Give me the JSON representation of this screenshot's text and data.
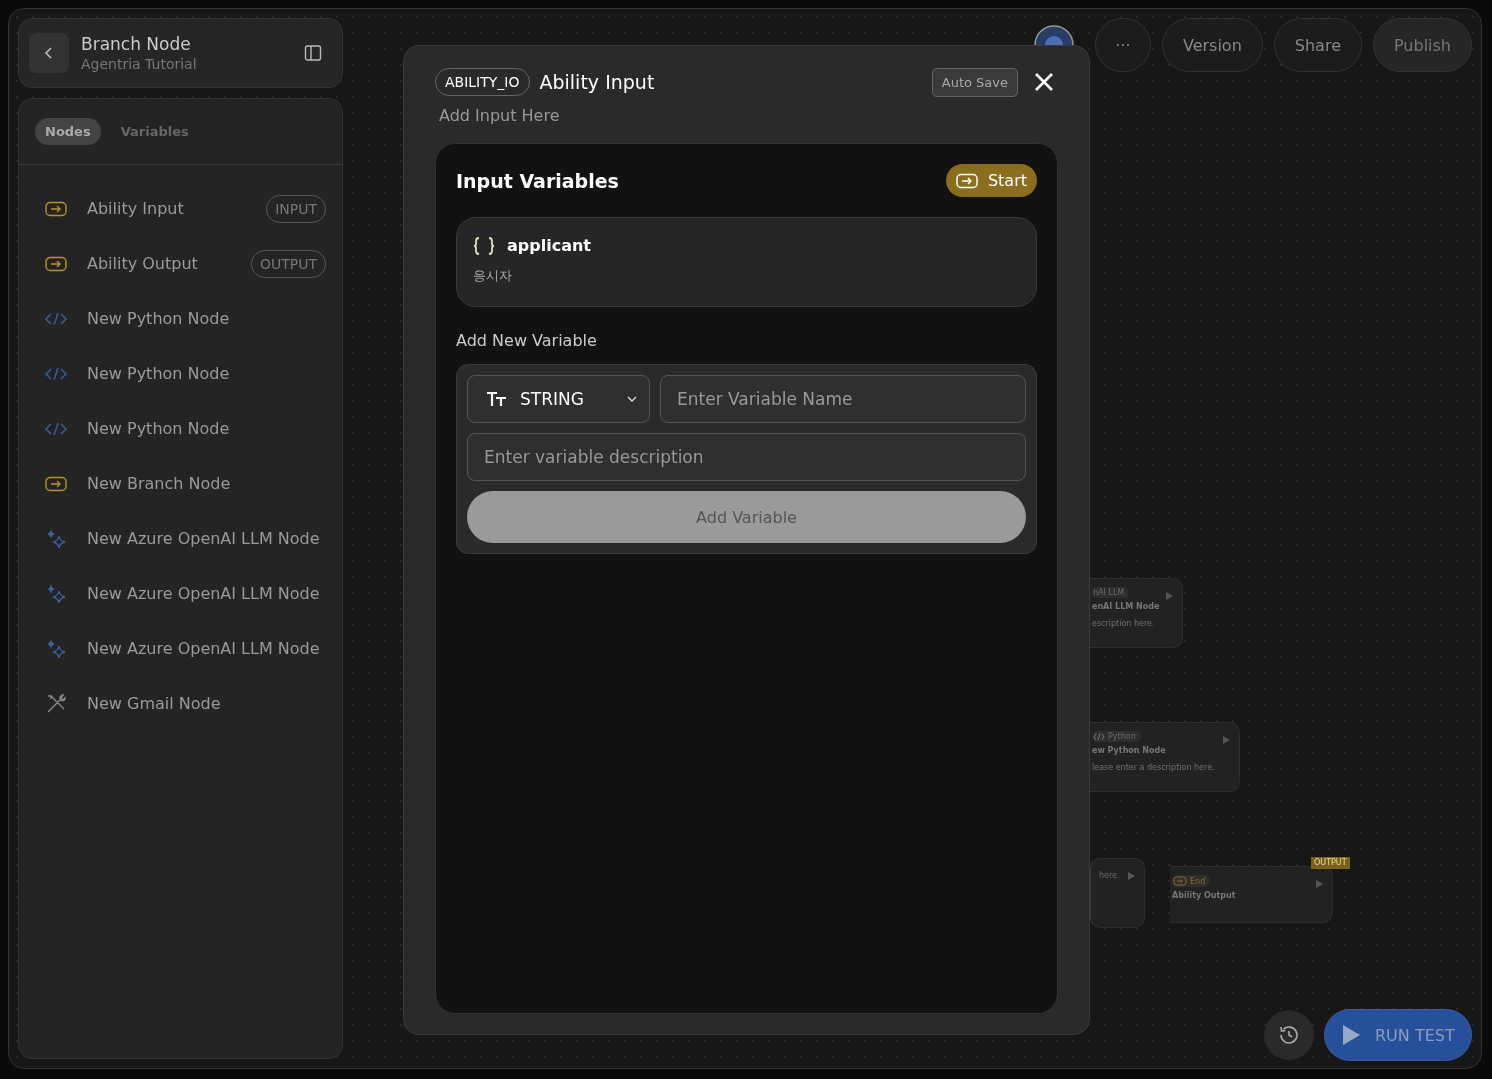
{
  "header": {
    "title": "Branch Node",
    "subtitle": "Agentria Tutorial"
  },
  "sidebar": {
    "tabs": [
      {
        "label": "Nodes",
        "selected": true
      },
      {
        "label": "Variables",
        "selected": false
      }
    ],
    "items": [
      {
        "label": "Ability Input",
        "kind": "io",
        "badge": "INPUT"
      },
      {
        "label": "Ability Output",
        "kind": "io",
        "badge": "OUTPUT"
      },
      {
        "label": "New Python Node",
        "kind": "code"
      },
      {
        "label": "New Python Node",
        "kind": "code"
      },
      {
        "label": "New Python Node",
        "kind": "code"
      },
      {
        "label": "New Branch Node",
        "kind": "io"
      },
      {
        "label": "New Azure OpenAI LLM Node",
        "kind": "sparkle"
      },
      {
        "label": "New Azure OpenAI LLM Node",
        "kind": "sparkle"
      },
      {
        "label": "New Azure OpenAI LLM Node",
        "kind": "sparkle"
      },
      {
        "label": "New Gmail Node",
        "kind": "tool"
      }
    ]
  },
  "toolbar": {
    "more": "···",
    "buttons": [
      "Version",
      "Share",
      "Publish"
    ]
  },
  "canvas_nodes": [
    {
      "tag": "nAI LLM",
      "title": "enAI LLM Node",
      "description": "escription here."
    },
    {
      "kind": "code",
      "tag": "Python",
      "title": "ew Python Node",
      "description": "lease enter a description here."
    },
    {
      "description": "here."
    },
    {
      "kind": "io",
      "tag": "End",
      "title": "Ability Output",
      "badge": "OUTPUT"
    }
  ],
  "run_test": {
    "label": "RUN TEST"
  },
  "modal": {
    "tag": "ABILITY_IO",
    "title": "Ability Input",
    "subtitle": "Add Input Here",
    "auto_save": "Auto Save",
    "input_variables": {
      "title": "Input Variables",
      "start": "Start",
      "variables": [
        {
          "name": "applicant",
          "description": "응시자"
        }
      ]
    },
    "add_new": {
      "label": "Add New Variable",
      "type": "STRING",
      "name_placeholder": "Enter Variable Name",
      "description_placeholder": "Enter variable description",
      "button": "Add Variable"
    }
  }
}
